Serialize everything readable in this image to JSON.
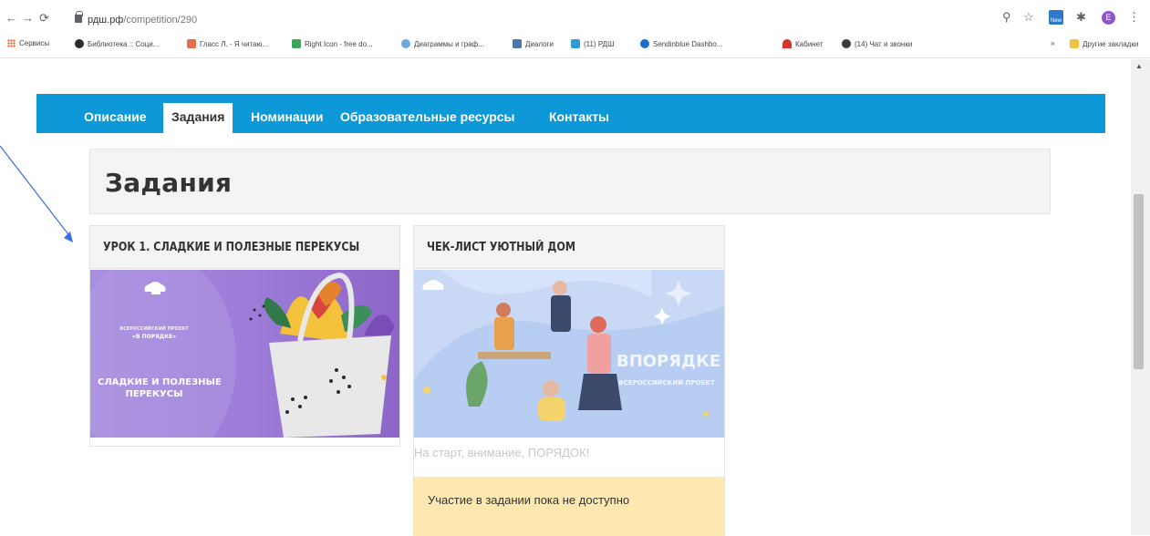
{
  "browser": {
    "url_host": "рдш.рф",
    "url_path": "/competition/290",
    "bookmarks": [
      "Сервисы",
      "Библиотека :: Соци...",
      "Гласс Л. - Я читаю...",
      "Right Icon - free do...",
      "Диаграммы и граф...",
      "Диалоги",
      "(11) РДШ",
      "Sendinblue Dashbo...",
      "Кабинет",
      "(14) Чат и звонки"
    ],
    "overflow_label": "»",
    "other_bookmarks": "Другие закладки",
    "profile_initial": "E",
    "ext_badge": "New"
  },
  "nav": {
    "items": [
      "Описание",
      "Задания",
      "Номинации",
      "Образовательные ресурсы",
      "Контакты"
    ],
    "active_index": 1
  },
  "page": {
    "title": "Задания"
  },
  "cards": [
    {
      "title": "УРОК 1. СЛАДКИЕ И ПОЛЕЗНЫЕ ПЕРЕКУСЫ",
      "image_lines": [
        "ВСЕРОССИЙСКИЙ ПРОЕКТ",
        "«В ПОРЯДКЕ»",
        "СЛАДКИЕ И ПОЛЕЗНЫЕ",
        "ПЕРЕКУСЫ"
      ]
    },
    {
      "title": "ЧЕК-ЛИСТ УЮТНЫЙ ДОМ",
      "image_lines": [
        "ВПОРЯДКЕ",
        "ВСЕРОССИЙСКИЙ ПРОЕКТ"
      ],
      "subtitle": "На старт, внимание, ПОРЯДОК!",
      "notice": "Участие в задании пока не доступно"
    }
  ],
  "colors": {
    "nav_bg": "#0d98d7",
    "notice_bg": "#fde8b0",
    "annotation_arrow": "#3a6fd8"
  }
}
